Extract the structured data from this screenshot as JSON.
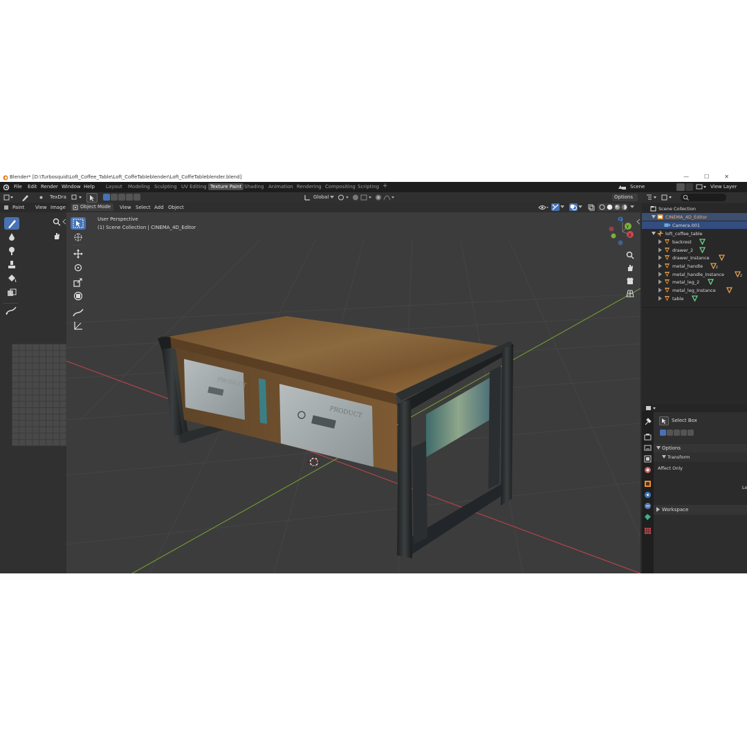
{
  "window": {
    "title": "Blender* [D:\\Turbosquid\\Loft_Coffee_Table\\Loft_CoffeTableblender\\Loft_CoffeTableblender.blend]"
  },
  "menu": [
    "File",
    "Edit",
    "Render",
    "Window",
    "Help"
  ],
  "workspaces": [
    {
      "label": "Layout",
      "active": false
    },
    {
      "label": "Modeling",
      "active": false
    },
    {
      "label": "Sculpting",
      "active": false
    },
    {
      "label": "UV Editing",
      "active": false
    },
    {
      "label": "Texture Paint",
      "active": true
    },
    {
      "label": "Shading",
      "active": false
    },
    {
      "label": "Animation",
      "active": false
    },
    {
      "label": "Rendering",
      "active": false
    },
    {
      "label": "Compositing",
      "active": false
    },
    {
      "label": "Scripting",
      "active": false
    }
  ],
  "add_workspace": "+",
  "scene": {
    "label": "Scene",
    "view_layer": "View Layer"
  },
  "image_editor": {
    "brush": "TexDrav",
    "menus": [
      "Paint",
      "View",
      "Image"
    ]
  },
  "viewport": {
    "mode": "Object Mode",
    "menus": [
      "View",
      "Select",
      "Add",
      "Object"
    ],
    "orientation": "Global",
    "options": "Options",
    "info_line1": "User Perspective",
    "info_line2": "(1) Scene Collection | CINEMA_4D_Editor"
  },
  "gizmo": {
    "x": "X",
    "y": "Y",
    "z": "Z"
  },
  "outliner": {
    "search_placeholder": "",
    "rows": [
      {
        "label": "Scene Collection",
        "indent": 0,
        "type": "collection"
      },
      {
        "label": "CINEMA_4D_Editor",
        "indent": 1,
        "type": "collection",
        "highlight": true,
        "orange": true
      },
      {
        "label": "Camera.001",
        "indent": 2,
        "type": "camera",
        "selected": true
      },
      {
        "label": "loft_coffee_table",
        "indent": 1,
        "type": "empty"
      },
      {
        "label": "backrest",
        "indent": 2,
        "type": "mesh",
        "data": ""
      },
      {
        "label": "drawer_2",
        "indent": 2,
        "type": "mesh",
        "data": ""
      },
      {
        "label": "drawer_Instance",
        "indent": 2,
        "type": "mesh",
        "data": ""
      },
      {
        "label": "metal_handle",
        "indent": 2,
        "type": "mesh",
        "data": "2"
      },
      {
        "label": "metal_handle_Instance",
        "indent": 2,
        "type": "mesh",
        "data": "2"
      },
      {
        "label": "metal_leg_2",
        "indent": 2,
        "type": "mesh",
        "data": ""
      },
      {
        "label": "metal_leg_Instance",
        "indent": 2,
        "type": "mesh",
        "data": ""
      },
      {
        "label": "table",
        "indent": 2,
        "type": "mesh",
        "data": ""
      }
    ]
  },
  "properties": {
    "tool_name": "Select Box",
    "options": "Options",
    "transform": "Transform",
    "affect_only": "Affect Only",
    "cut_text": "Lo",
    "workspace": "Workspace"
  },
  "colors": {
    "accent": "#4772b3",
    "x_axis": "#c84850",
    "y_axis": "#7fae3c",
    "z_axis": "#3f79c8",
    "orange": "#e8a04c",
    "mesh_green": "#6fd08c"
  }
}
